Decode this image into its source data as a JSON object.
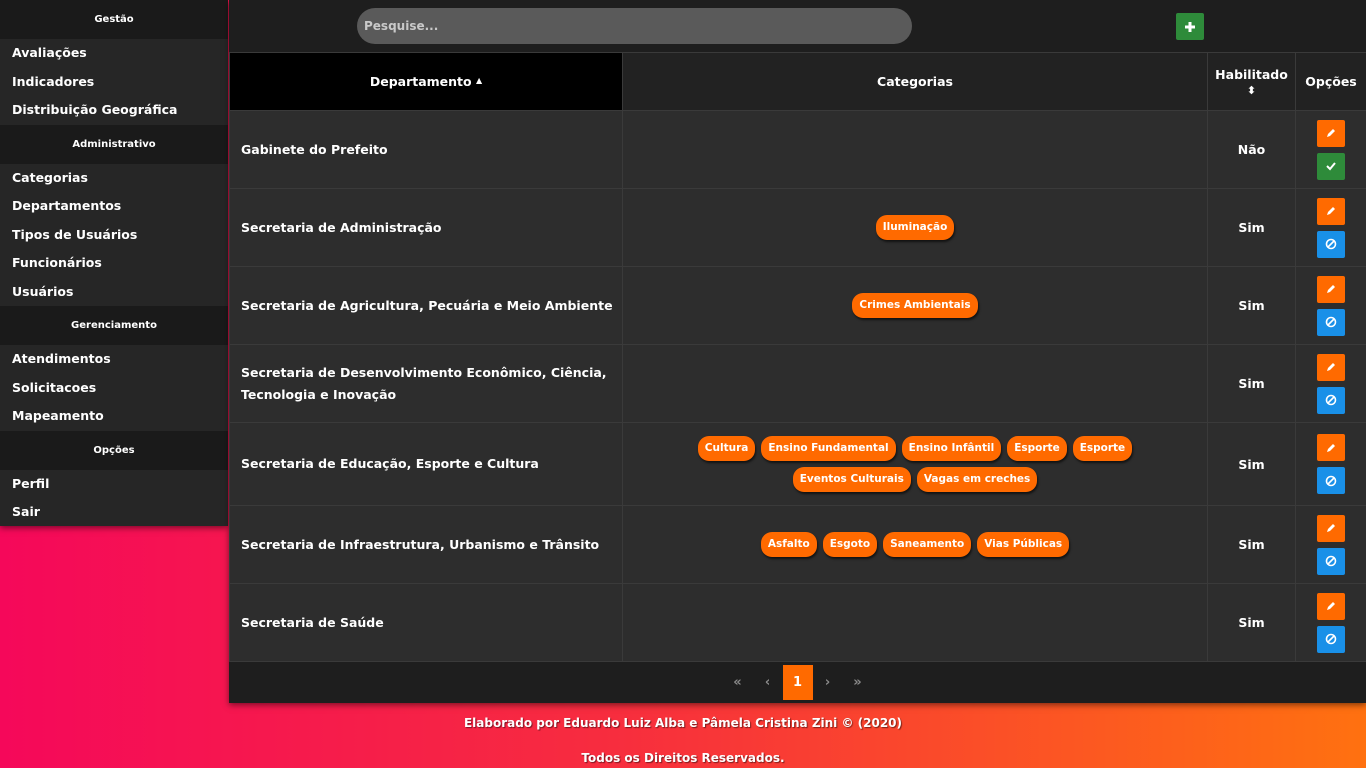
{
  "sidebar": {
    "sections": [
      {
        "title": "Gestão",
        "items": [
          "Avaliações",
          "Indicadores",
          "Distribuição Geográfica"
        ]
      },
      {
        "title": "Administrativo",
        "items": [
          "Categorias",
          "Departamentos",
          "Tipos de Usuários",
          "Funcionários",
          "Usuários"
        ]
      },
      {
        "title": "Gerenciamento",
        "items": [
          "Atendimentos",
          "Solicitacoes",
          "Mapeamento"
        ]
      },
      {
        "title": "Opções",
        "items": [
          "Perfil",
          "Sair"
        ]
      }
    ]
  },
  "search": {
    "placeholder": "Pesquise..."
  },
  "table": {
    "headers": {
      "departamento": "Departamento",
      "sort_arrow": "▲",
      "categorias": "Categorias",
      "habilitado": "Habilitado",
      "sort_both": "⬍",
      "opcoes": "Opções"
    },
    "rows": [
      {
        "dept": "Gabinete do Prefeito",
        "tags": [],
        "enabled": "Não",
        "toggle": "enable"
      },
      {
        "dept": "Secretaria de Administração",
        "tags": [
          "Iluminação"
        ],
        "enabled": "Sim",
        "toggle": "disable"
      },
      {
        "dept": "Secretaria de Agricultura, Pecuária e Meio Ambiente",
        "tags": [
          "Crimes Ambientais"
        ],
        "enabled": "Sim",
        "toggle": "disable"
      },
      {
        "dept": "Secretaria de Desenvolvimento Econômico, Ciência, Tecnologia e Inovação",
        "tags": [],
        "enabled": "Sim",
        "toggle": "disable"
      },
      {
        "dept": "Secretaria de Educação, Esporte e Cultura",
        "tags": [
          "Cultura",
          "Ensino Fundamental",
          "Ensino Infântil",
          "Esporte",
          "Esporte",
          "Eventos Culturais",
          "Vagas em creches"
        ],
        "enabled": "Sim",
        "toggle": "disable"
      },
      {
        "dept": "Secretaria de Infraestrutura, Urbanismo e Trânsito",
        "tags": [
          "Asfalto",
          "Esgoto",
          "Saneamento",
          "Vias Públicas"
        ],
        "enabled": "Sim",
        "toggle": "disable"
      },
      {
        "dept": "Secretaria de Saúde",
        "tags": [],
        "enabled": "Sim",
        "toggle": "disable"
      }
    ]
  },
  "pagination": {
    "first": "«",
    "prev": "‹",
    "current": "1",
    "next": "›",
    "last": "»"
  },
  "footer": {
    "credits": "Elaborado por Eduardo Luiz Alba e Pâmela Cristina Zini © (2020)",
    "rights": "Todos os Direitos Reservados."
  },
  "colors": {
    "accent": "#ff6a00",
    "success": "#2e8b3a",
    "info": "#1990e8"
  }
}
